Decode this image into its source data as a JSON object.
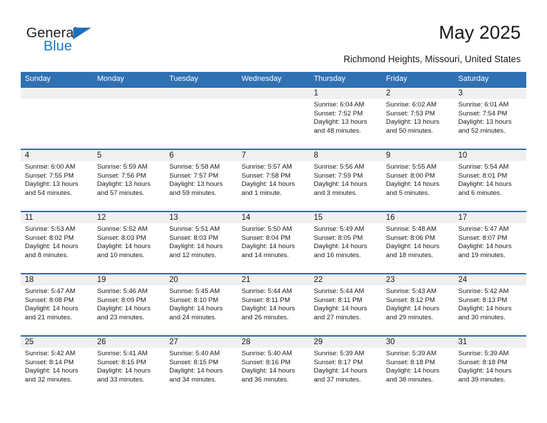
{
  "brand": {
    "name_part1": "General",
    "name_part2": "Blue",
    "triangle_color": "#1d6fb8",
    "blue_text_color": "#1878c8"
  },
  "header": {
    "title": "May 2025",
    "location": "Richmond Heights, Missouri, United States"
  },
  "theme": {
    "header_blue": "#3071b4",
    "row_rule_blue": "#2c6cad",
    "day_band_gray": "#f0f0f0"
  },
  "weekdays": [
    "Sunday",
    "Monday",
    "Tuesday",
    "Wednesday",
    "Thursday",
    "Friday",
    "Saturday"
  ],
  "weeks": [
    [
      {
        "day": "",
        "sunrise": "",
        "sunset": "",
        "daylight_line1": "",
        "daylight_line2": ""
      },
      {
        "day": "",
        "sunrise": "",
        "sunset": "",
        "daylight_line1": "",
        "daylight_line2": ""
      },
      {
        "day": "",
        "sunrise": "",
        "sunset": "",
        "daylight_line1": "",
        "daylight_line2": ""
      },
      {
        "day": "",
        "sunrise": "",
        "sunset": "",
        "daylight_line1": "",
        "daylight_line2": ""
      },
      {
        "day": "1",
        "sunrise": "Sunrise: 6:04 AM",
        "sunset": "Sunset: 7:52 PM",
        "daylight_line1": "Daylight: 13 hours",
        "daylight_line2": "and 48 minutes."
      },
      {
        "day": "2",
        "sunrise": "Sunrise: 6:02 AM",
        "sunset": "Sunset: 7:53 PM",
        "daylight_line1": "Daylight: 13 hours",
        "daylight_line2": "and 50 minutes."
      },
      {
        "day": "3",
        "sunrise": "Sunrise: 6:01 AM",
        "sunset": "Sunset: 7:54 PM",
        "daylight_line1": "Daylight: 13 hours",
        "daylight_line2": "and 52 minutes."
      }
    ],
    [
      {
        "day": "4",
        "sunrise": "Sunrise: 6:00 AM",
        "sunset": "Sunset: 7:55 PM",
        "daylight_line1": "Daylight: 13 hours",
        "daylight_line2": "and 54 minutes."
      },
      {
        "day": "5",
        "sunrise": "Sunrise: 5:59 AM",
        "sunset": "Sunset: 7:56 PM",
        "daylight_line1": "Daylight: 13 hours",
        "daylight_line2": "and 57 minutes."
      },
      {
        "day": "6",
        "sunrise": "Sunrise: 5:58 AM",
        "sunset": "Sunset: 7:57 PM",
        "daylight_line1": "Daylight: 13 hours",
        "daylight_line2": "and 59 minutes."
      },
      {
        "day": "7",
        "sunrise": "Sunrise: 5:57 AM",
        "sunset": "Sunset: 7:58 PM",
        "daylight_line1": "Daylight: 14 hours",
        "daylight_line2": "and 1 minute."
      },
      {
        "day": "8",
        "sunrise": "Sunrise: 5:56 AM",
        "sunset": "Sunset: 7:59 PM",
        "daylight_line1": "Daylight: 14 hours",
        "daylight_line2": "and 3 minutes."
      },
      {
        "day": "9",
        "sunrise": "Sunrise: 5:55 AM",
        "sunset": "Sunset: 8:00 PM",
        "daylight_line1": "Daylight: 14 hours",
        "daylight_line2": "and 5 minutes."
      },
      {
        "day": "10",
        "sunrise": "Sunrise: 5:54 AM",
        "sunset": "Sunset: 8:01 PM",
        "daylight_line1": "Daylight: 14 hours",
        "daylight_line2": "and 6 minutes."
      }
    ],
    [
      {
        "day": "11",
        "sunrise": "Sunrise: 5:53 AM",
        "sunset": "Sunset: 8:02 PM",
        "daylight_line1": "Daylight: 14 hours",
        "daylight_line2": "and 8 minutes."
      },
      {
        "day": "12",
        "sunrise": "Sunrise: 5:52 AM",
        "sunset": "Sunset: 8:03 PM",
        "daylight_line1": "Daylight: 14 hours",
        "daylight_line2": "and 10 minutes."
      },
      {
        "day": "13",
        "sunrise": "Sunrise: 5:51 AM",
        "sunset": "Sunset: 8:03 PM",
        "daylight_line1": "Daylight: 14 hours",
        "daylight_line2": "and 12 minutes."
      },
      {
        "day": "14",
        "sunrise": "Sunrise: 5:50 AM",
        "sunset": "Sunset: 8:04 PM",
        "daylight_line1": "Daylight: 14 hours",
        "daylight_line2": "and 14 minutes."
      },
      {
        "day": "15",
        "sunrise": "Sunrise: 5:49 AM",
        "sunset": "Sunset: 8:05 PM",
        "daylight_line1": "Daylight: 14 hours",
        "daylight_line2": "and 16 minutes."
      },
      {
        "day": "16",
        "sunrise": "Sunrise: 5:48 AM",
        "sunset": "Sunset: 8:06 PM",
        "daylight_line1": "Daylight: 14 hours",
        "daylight_line2": "and 18 minutes."
      },
      {
        "day": "17",
        "sunrise": "Sunrise: 5:47 AM",
        "sunset": "Sunset: 8:07 PM",
        "daylight_line1": "Daylight: 14 hours",
        "daylight_line2": "and 19 minutes."
      }
    ],
    [
      {
        "day": "18",
        "sunrise": "Sunrise: 5:47 AM",
        "sunset": "Sunset: 8:08 PM",
        "daylight_line1": "Daylight: 14 hours",
        "daylight_line2": "and 21 minutes."
      },
      {
        "day": "19",
        "sunrise": "Sunrise: 5:46 AM",
        "sunset": "Sunset: 8:09 PM",
        "daylight_line1": "Daylight: 14 hours",
        "daylight_line2": "and 23 minutes."
      },
      {
        "day": "20",
        "sunrise": "Sunrise: 5:45 AM",
        "sunset": "Sunset: 8:10 PM",
        "daylight_line1": "Daylight: 14 hours",
        "daylight_line2": "and 24 minutes."
      },
      {
        "day": "21",
        "sunrise": "Sunrise: 5:44 AM",
        "sunset": "Sunset: 8:11 PM",
        "daylight_line1": "Daylight: 14 hours",
        "daylight_line2": "and 26 minutes."
      },
      {
        "day": "22",
        "sunrise": "Sunrise: 5:44 AM",
        "sunset": "Sunset: 8:11 PM",
        "daylight_line1": "Daylight: 14 hours",
        "daylight_line2": "and 27 minutes."
      },
      {
        "day": "23",
        "sunrise": "Sunrise: 5:43 AM",
        "sunset": "Sunset: 8:12 PM",
        "daylight_line1": "Daylight: 14 hours",
        "daylight_line2": "and 29 minutes."
      },
      {
        "day": "24",
        "sunrise": "Sunrise: 5:42 AM",
        "sunset": "Sunset: 8:13 PM",
        "daylight_line1": "Daylight: 14 hours",
        "daylight_line2": "and 30 minutes."
      }
    ],
    [
      {
        "day": "25",
        "sunrise": "Sunrise: 5:42 AM",
        "sunset": "Sunset: 8:14 PM",
        "daylight_line1": "Daylight: 14 hours",
        "daylight_line2": "and 32 minutes."
      },
      {
        "day": "26",
        "sunrise": "Sunrise: 5:41 AM",
        "sunset": "Sunset: 8:15 PM",
        "daylight_line1": "Daylight: 14 hours",
        "daylight_line2": "and 33 minutes."
      },
      {
        "day": "27",
        "sunrise": "Sunrise: 5:40 AM",
        "sunset": "Sunset: 8:15 PM",
        "daylight_line1": "Daylight: 14 hours",
        "daylight_line2": "and 34 minutes."
      },
      {
        "day": "28",
        "sunrise": "Sunrise: 5:40 AM",
        "sunset": "Sunset: 8:16 PM",
        "daylight_line1": "Daylight: 14 hours",
        "daylight_line2": "and 36 minutes."
      },
      {
        "day": "29",
        "sunrise": "Sunrise: 5:39 AM",
        "sunset": "Sunset: 8:17 PM",
        "daylight_line1": "Daylight: 14 hours",
        "daylight_line2": "and 37 minutes."
      },
      {
        "day": "30",
        "sunrise": "Sunrise: 5:39 AM",
        "sunset": "Sunset: 8:18 PM",
        "daylight_line1": "Daylight: 14 hours",
        "daylight_line2": "and 38 minutes."
      },
      {
        "day": "31",
        "sunrise": "Sunrise: 5:39 AM",
        "sunset": "Sunset: 8:18 PM",
        "daylight_line1": "Daylight: 14 hours",
        "daylight_line2": "and 39 minutes."
      }
    ]
  ]
}
